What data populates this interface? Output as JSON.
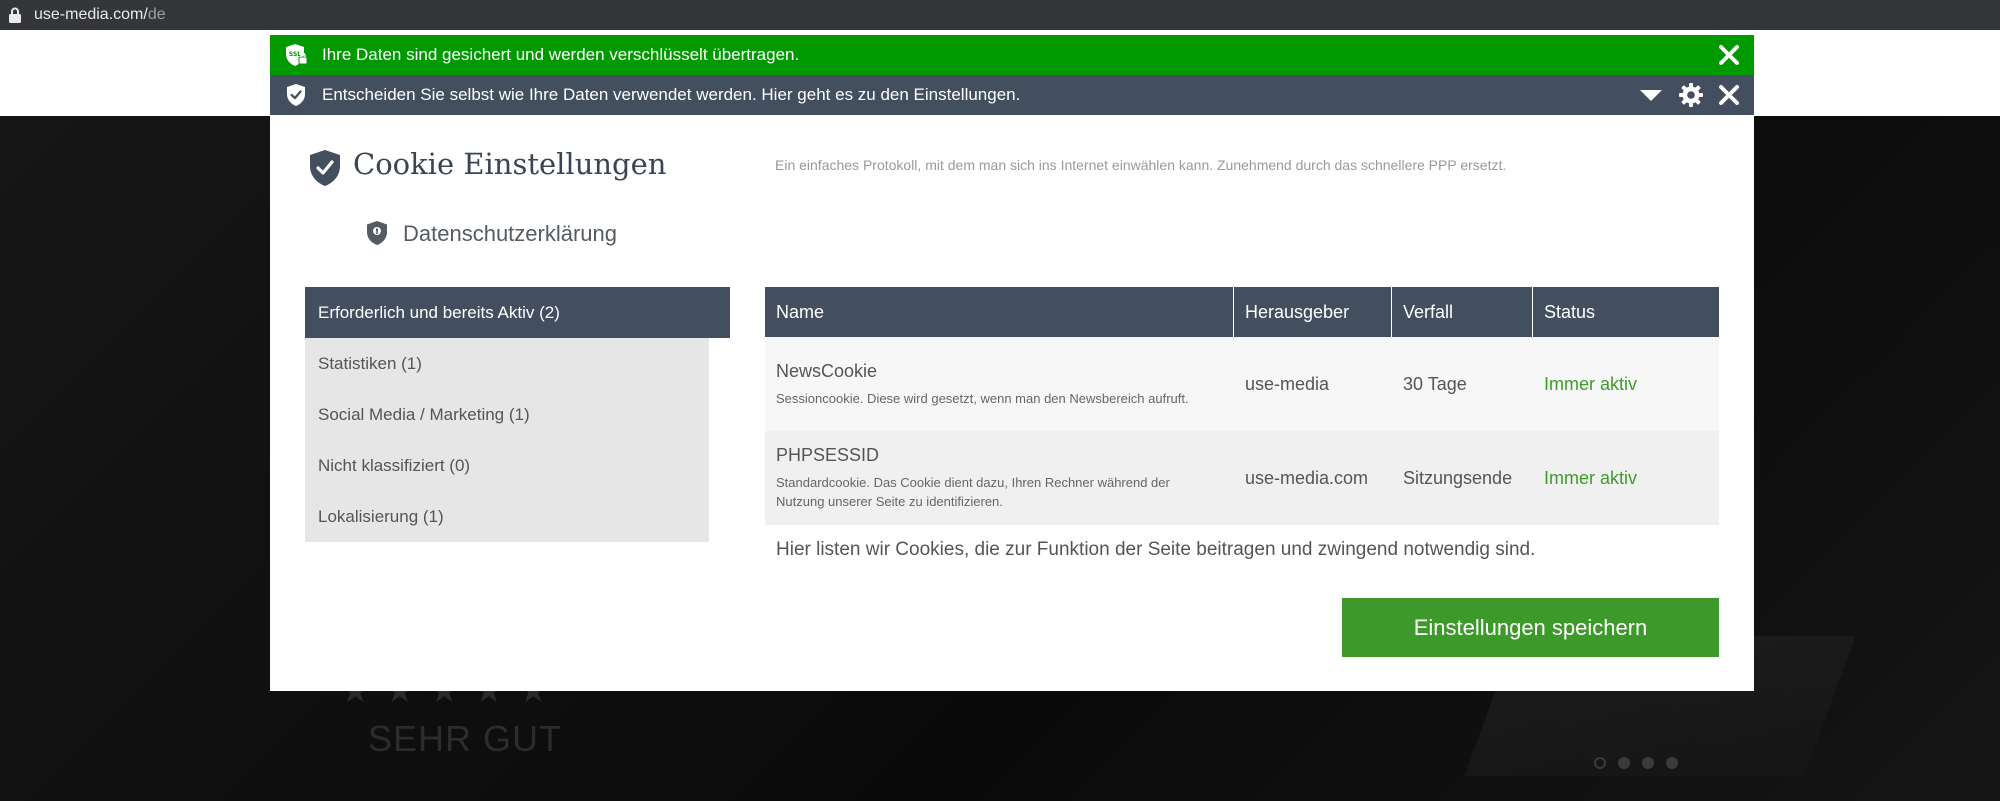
{
  "browser": {
    "url_host": "use-media.com/",
    "url_path": "de"
  },
  "background": {
    "rating_text": "SEHR GUT"
  },
  "ssl_bar": {
    "text": "Ihre Daten sind gesichert und werden verschlüsselt übertragen.",
    "color": "#009900"
  },
  "info_bar": {
    "text": "Entscheiden Sie selbst wie Ihre Daten verwendet werden. Hier geht es zu den Einstellungen.",
    "color": "#434e5e"
  },
  "modal": {
    "title": "Cookie Einstellungen",
    "description": "Ein einfaches Protokoll, mit dem man sich ins Internet einwählen kann. Zunehmend durch das schnellere PPP ersetzt.",
    "privacy_link": "Datenschutzerklärung",
    "categories": [
      {
        "label": "Erforderlich und bereits Aktiv (2)",
        "active": true
      },
      {
        "label": "Statistiken (1)",
        "active": false
      },
      {
        "label": "Social Media / Marketing (1)",
        "active": false
      },
      {
        "label": "Nicht klassifiziert (0)",
        "active": false
      },
      {
        "label": "Lokalisierung (1)",
        "active": false
      }
    ],
    "table": {
      "headers": {
        "name": "Name",
        "publisher": "Herausgeber",
        "expiry": "Verfall",
        "status": "Status"
      },
      "rows": [
        {
          "name": "NewsCookie",
          "description": "Sessioncookie. Diese wird gesetzt, wenn man den Newsbereich aufruft.",
          "publisher": "use-media",
          "expiry": "30 Tage",
          "status": "Immer aktiv"
        },
        {
          "name": "PHPSESSID",
          "description": "Standardcookie. Das Cookie dient dazu, Ihren Rechner während der Nutzung unserer Seite zu identifizieren.",
          "publisher": "use-media.com",
          "expiry": "Sitzungsende",
          "status": "Immer aktiv"
        }
      ]
    },
    "note": "Hier listen wir Cookies, die zur Funktion der Seite beitragen und zwingend notwendig sind.",
    "save_button": "Einstellungen speichern"
  },
  "colors": {
    "accent_green": "#3d9a2a",
    "status_green": "#3f9b2a",
    "header_slate": "#434e5e"
  },
  "icons": [
    "lock-icon",
    "ssl-shield-icon",
    "shield-check-icon",
    "caret-down-icon",
    "gear-icon",
    "close-icon",
    "privacy-shield-icon",
    "star-icon"
  ]
}
